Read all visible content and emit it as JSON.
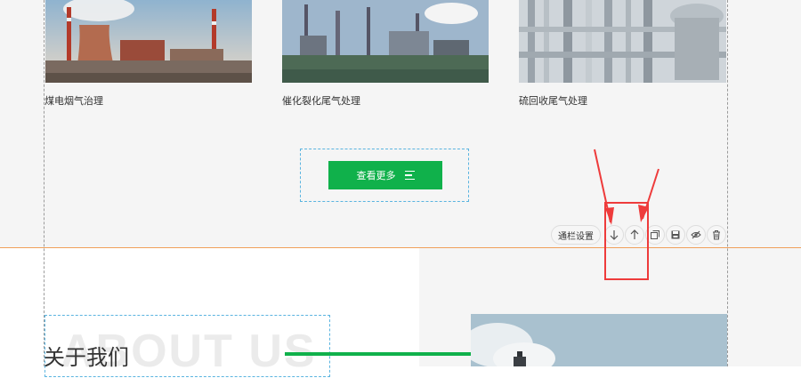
{
  "products": [
    {
      "caption": "煤电烟气治理",
      "image": "coal-power-plant-photo"
    },
    {
      "caption": "催化裂化尾气处理",
      "image": "refinery-photo"
    },
    {
      "caption": "硫回收尾气处理",
      "image": "industrial-pipes-photo"
    }
  ],
  "view_more": {
    "label": "查看更多",
    "icon": "menu-lines-icon"
  },
  "toolbar": {
    "settings_label": "通栏设置",
    "move_down_icon": "arrow-down-icon",
    "move_up_icon": "arrow-up-icon",
    "copy_icon": "copy-icon",
    "save_icon": "save-icon",
    "hide_icon": "eye-slash-icon",
    "delete_icon": "trash-icon"
  },
  "about": {
    "title": "关于我们",
    "bg_text": "ABOUT US"
  },
  "colors": {
    "brand_green": "#10b14b",
    "annotation_red": "#ee3b3b",
    "section_divider": "#f0a05a",
    "edit_frame": "#5ab4e0"
  }
}
